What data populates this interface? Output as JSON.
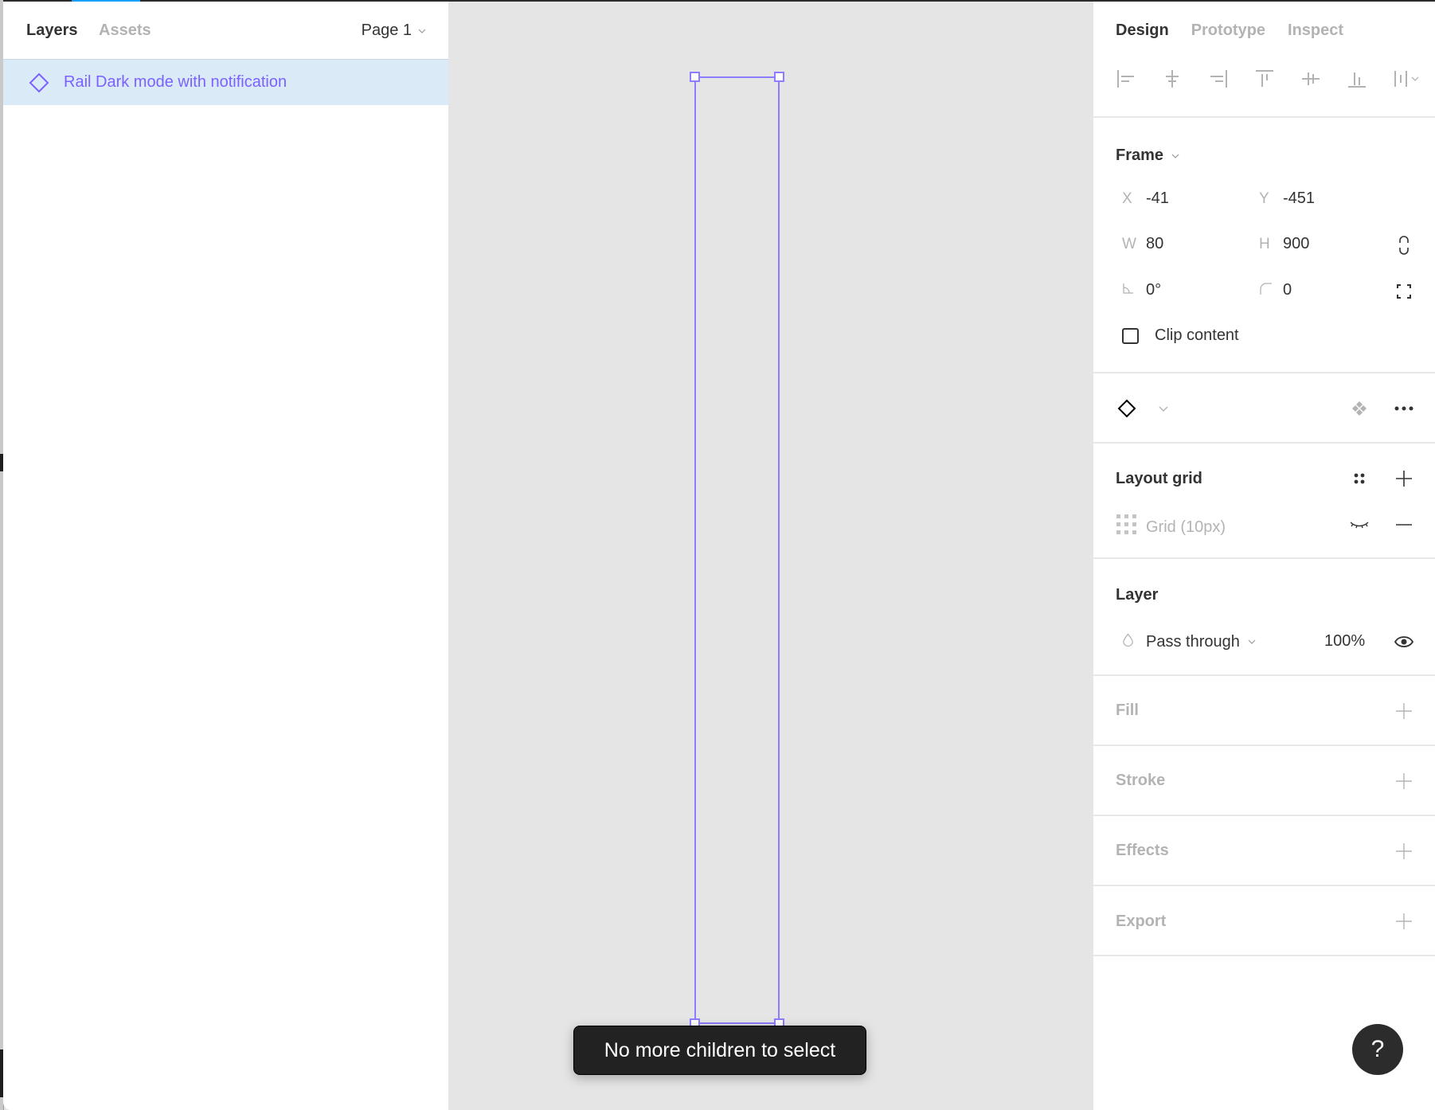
{
  "left_panel": {
    "tabs": [
      {
        "label": "Layers",
        "active": true
      },
      {
        "label": "Assets",
        "active": false
      }
    ],
    "page_selector": {
      "label": "Page 1",
      "icon": "chevron-down-icon"
    },
    "layers": [
      {
        "name": "Rail Dark mode with notification",
        "icon": "component-diamond-icon",
        "selected": true
      }
    ]
  },
  "canvas": {
    "tooltip": "No more children to select",
    "selection_color": "#8c7cff"
  },
  "right_panel": {
    "tabs": [
      {
        "label": "Design",
        "active": true
      },
      {
        "label": "Prototype",
        "active": false
      },
      {
        "label": "Inspect",
        "active": false
      }
    ],
    "align_tools": [
      "align-left-icon",
      "align-horizontal-center-icon",
      "align-right-icon",
      "align-top-icon",
      "align-vertical-center-icon",
      "align-bottom-icon",
      "distribute-icon"
    ],
    "frame": {
      "title": "Frame",
      "x_label": "X",
      "x": "-41",
      "y_label": "Y",
      "y": "-451",
      "w_label": "W",
      "w": "80",
      "h_label": "H",
      "h": "900",
      "rotation": "0°",
      "radius": "0",
      "clip_content_label": "Clip content",
      "clip_content": false
    },
    "component": {
      "icon": "component-diamond-icon"
    },
    "layout_grid": {
      "title": "Layout grid",
      "items": [
        {
          "label": "Grid (10px)",
          "visible": false
        }
      ]
    },
    "layer": {
      "title": "Layer",
      "blend_mode": "Pass through",
      "opacity": "100%"
    },
    "fill": {
      "title": "Fill"
    },
    "stroke": {
      "title": "Stroke"
    },
    "effects": {
      "title": "Effects"
    },
    "export": {
      "title": "Export"
    }
  },
  "help_button": {
    "label": "?"
  },
  "colors": {
    "accent": "#7b61ff",
    "selected_row": "#daebf7",
    "topbar_active": "#18a0fb"
  }
}
